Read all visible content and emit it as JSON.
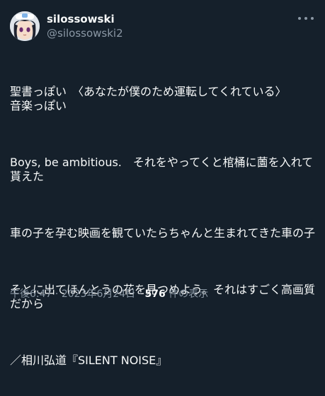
{
  "author": {
    "display_name": "silossowski",
    "handle": "@silossowski2",
    "avatar_icon": "anime-character-avatar"
  },
  "more_icon": "more-dots-icon",
  "body": {
    "paragraphs": [
      "聖書っぽい　〈あなたが僕のため運転してくれている〉\n音楽っぽい",
      "Boys, be ambitious.　それをやってくと棺桶に薗を入れて貰えた",
      "車の子を孕む映画を観ていたらちゃんと生まれてきた車の子",
      "そとに出てほんとうの花を見つめよう。それはすごく高画質だから",
      "／相川弘道『SILENT NOISE』"
    ]
  },
  "meta": {
    "time": "午後6:47",
    "separator1": " · ",
    "date": "2023年6月24日",
    "separator2": " · ",
    "view_count": "576",
    "view_label": " 件の表示"
  },
  "colors": {
    "background": "#15202b",
    "text": "#f7f9f9",
    "secondary": "#8b98a5"
  }
}
